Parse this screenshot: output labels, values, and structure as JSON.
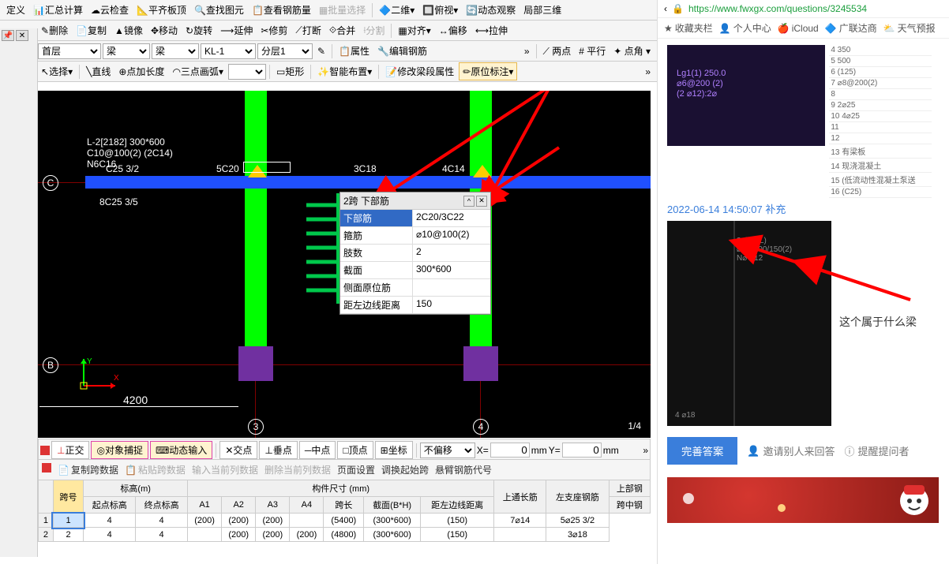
{
  "top_menu": [
    "定义",
    "汇总计算",
    "云检查",
    "平齐板顶",
    "查找图元",
    "查看钢筋量",
    "批量选择",
    "二维",
    "俯视",
    "动态观察",
    "局部三维"
  ],
  "toolbar2": [
    "删除",
    "复制",
    "镜像",
    "移动",
    "旋转",
    "延伸",
    "修剪",
    "打断",
    "合并",
    "分割",
    "对齐",
    "偏移",
    "拉伸"
  ],
  "toolbar3_selects": [
    "首层",
    "梁",
    "梁",
    "KL-1",
    "分层1"
  ],
  "toolbar3_right": [
    "属性",
    "编辑钢筋"
  ],
  "toolbar4": [
    "选择",
    "直线",
    "点加长度",
    "三点画弧",
    "矩形",
    "智能布置",
    "修改梁段属性",
    "原位标注"
  ],
  "status_bar": {
    "buttons": [
      "正交",
      "对象捕捉",
      "动态输入",
      "交点",
      "垂点",
      "中点",
      "顶点",
      "坐标"
    ],
    "select": "不偏移",
    "x_label": "X=",
    "x_val": "0",
    "x_unit": "mm",
    "y_label": "Y=",
    "y_val": "0",
    "y_unit": "mm"
  },
  "data_toolbar": [
    "复制跨数据",
    "粘贴跨数据",
    "输入当前列数据",
    "删除当前列数据",
    "页面设置",
    "调换起始跨",
    "悬臂钢筋代号"
  ],
  "table": {
    "group1": "标高(m)",
    "group2": "构件尺寸 (mm)",
    "group3": "上部钢",
    "headers": [
      "跨号",
      "起点标高",
      "终点标高",
      "A1",
      "A2",
      "A3",
      "A4",
      "跨长",
      "截面(B*H)",
      "距左边线距离",
      "上通长筋",
      "左支座钢筋",
      "跨中钢"
    ],
    "rows": [
      [
        "1",
        "1",
        "4",
        "4",
        "(200)",
        "(200)",
        "(200)",
        "",
        "(5400)",
        "(300*600)",
        "(150)",
        "7⌀14",
        "5⌀25 3/2"
      ],
      [
        "2",
        "2",
        "4",
        "4",
        "",
        "(200)",
        "(200)",
        "(200)",
        "(4800)",
        "(300*600)",
        "(150)",
        "",
        "3⌀18"
      ]
    ]
  },
  "panel": {
    "title": "2跨 下部筋",
    "rows": [
      {
        "label": "下部筋",
        "value": "2C20/3C22",
        "selected": true
      },
      {
        "label": "箍筋",
        "value": "⌀10@100(2)"
      },
      {
        "label": "肢数",
        "value": "2"
      },
      {
        "label": "截面",
        "value": "300*600"
      },
      {
        "label": "侧面原位筋",
        "value": ""
      },
      {
        "label": "距左边线距离",
        "value": "150"
      }
    ]
  },
  "canvas_text": {
    "l1": "L-2[2182] 300*600",
    "l2": "C10@100(2)  (2C14)",
    "l3": "N6C16",
    "t1": "C25 3/2",
    "t2": "5C20",
    "t3": "3C18",
    "t4": "4C14",
    "b1": "8C25 3/5",
    "dim": "4200",
    "frac": "1/4"
  },
  "grid_labels": {
    "c": "C",
    "b": "B",
    "n3": "3",
    "n4": "4"
  },
  "right": {
    "url": "https://www.fwxgx.com/questions/3245534",
    "bookmarks": [
      "收藏夹栏",
      "个人中心",
      "iCloud",
      "广联达商",
      "天气预报"
    ],
    "prop_rows": [
      "350",
      "500",
      "(125)",
      "⌀8@200(2)",
      "",
      "2⌀25",
      "4⌀25",
      "",
      "",
      "有梁板",
      "现浇混凝土",
      "(低流动性混凝土泵送",
      "(C25)"
    ],
    "timestamp": "2022-06-14 14:50:07 补充",
    "question": "这个属于什么梁",
    "btn": "完善答案",
    "link1": "邀请别人来回答",
    "link2": "提醒提问者"
  }
}
